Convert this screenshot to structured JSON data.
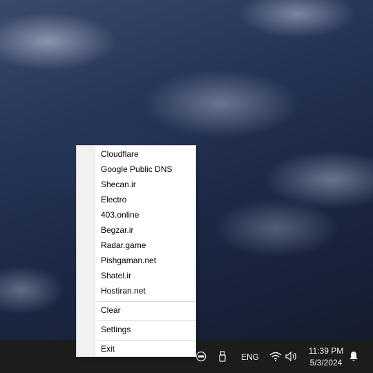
{
  "menu": {
    "dns_items": [
      "Cloudflare",
      "Google Public DNS",
      "Shecan.ir",
      "Electro",
      "403.online",
      "Begzar.ir",
      "Radar.game",
      "Pishgaman.net",
      "Shatel.ir",
      "Hostiran.net"
    ],
    "clear_label": "Clear",
    "settings_label": "Settings",
    "exit_label": "Exit"
  },
  "taskbar": {
    "language": "ENG",
    "time": "11:39 PM",
    "date": "5/3/2024",
    "icons": [
      "app-tray-icon",
      "usb-drive-icon",
      "wifi-icon",
      "volume-icon",
      "notification-bell-icon"
    ]
  }
}
